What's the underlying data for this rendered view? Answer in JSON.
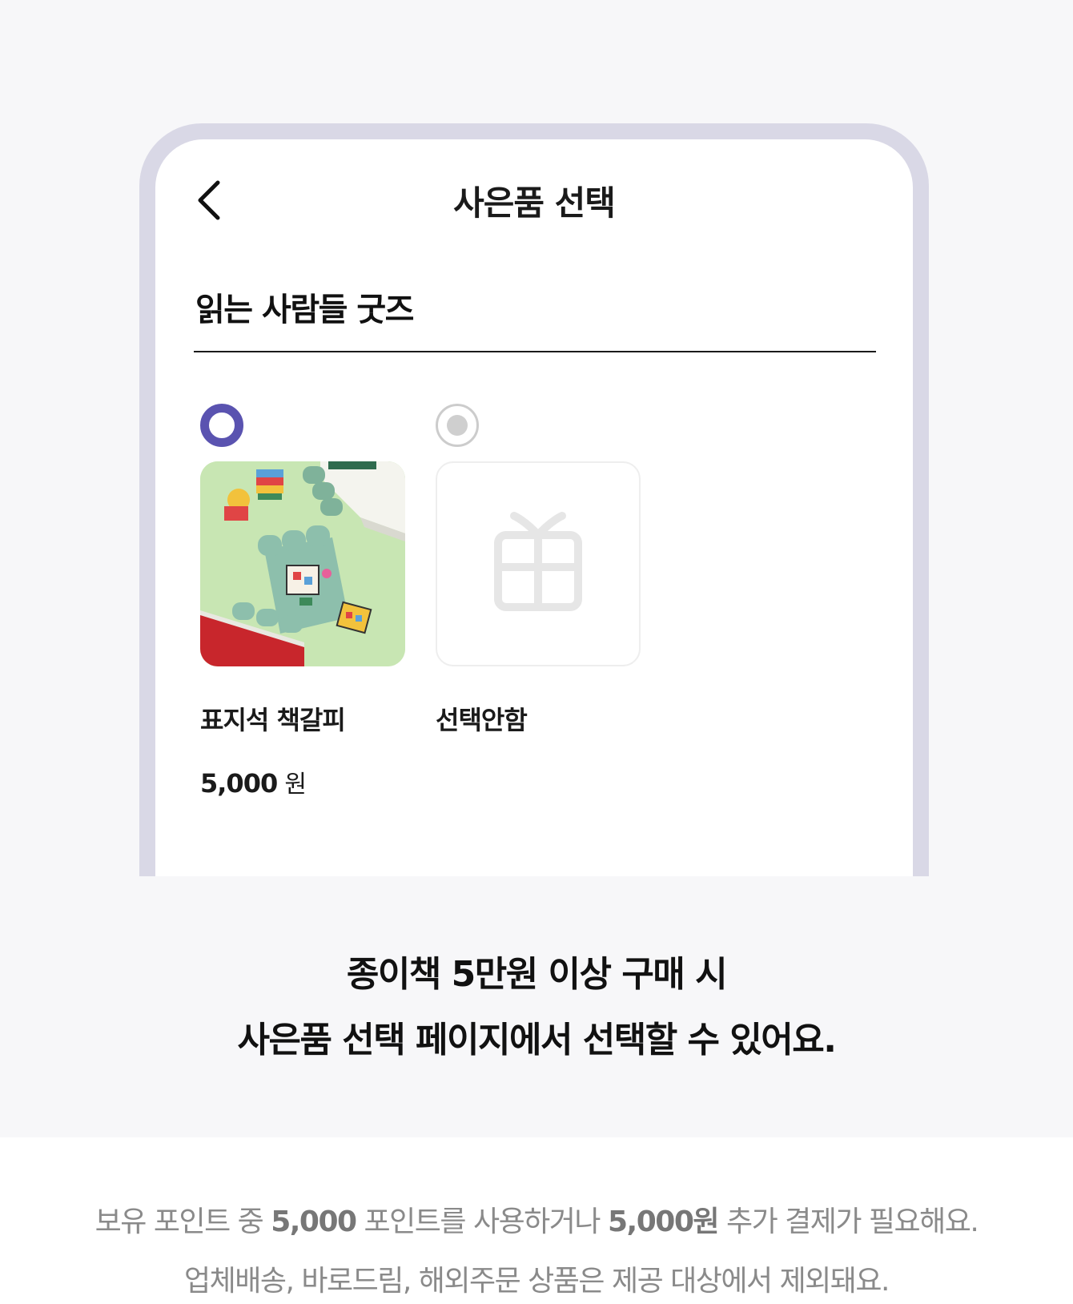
{
  "screen": {
    "title": "사은품 선택",
    "section_title": "읽는 사람들 굿즈"
  },
  "options": [
    {
      "label": "표지석 책갈피",
      "price_value": "5,000",
      "price_unit": "원",
      "selected": true,
      "image": "bookmark-product-photo"
    },
    {
      "label": "선택안함",
      "selected": false,
      "image": "gift-box-icon"
    }
  ],
  "caption": {
    "line1": "종이책 5만원 이상 구매 시",
    "line2": "사은품 선택 페이지에서 선택할 수 있어요."
  },
  "notes": {
    "line1_a": "보유 포인트 중 ",
    "line1_b": "5,000",
    "line1_c": " 포인트를 사용하거나 ",
    "line1_d": "5,000원",
    "line1_e": " 추가 결제가 필요해요.",
    "line2": "업체배송, 바로드림, 해외주문 상품은 제공 대상에서 제외돼요."
  },
  "colors": {
    "accent": "#5a53b0",
    "frame": "#d9d8e6",
    "background": "#f7f7f9"
  }
}
